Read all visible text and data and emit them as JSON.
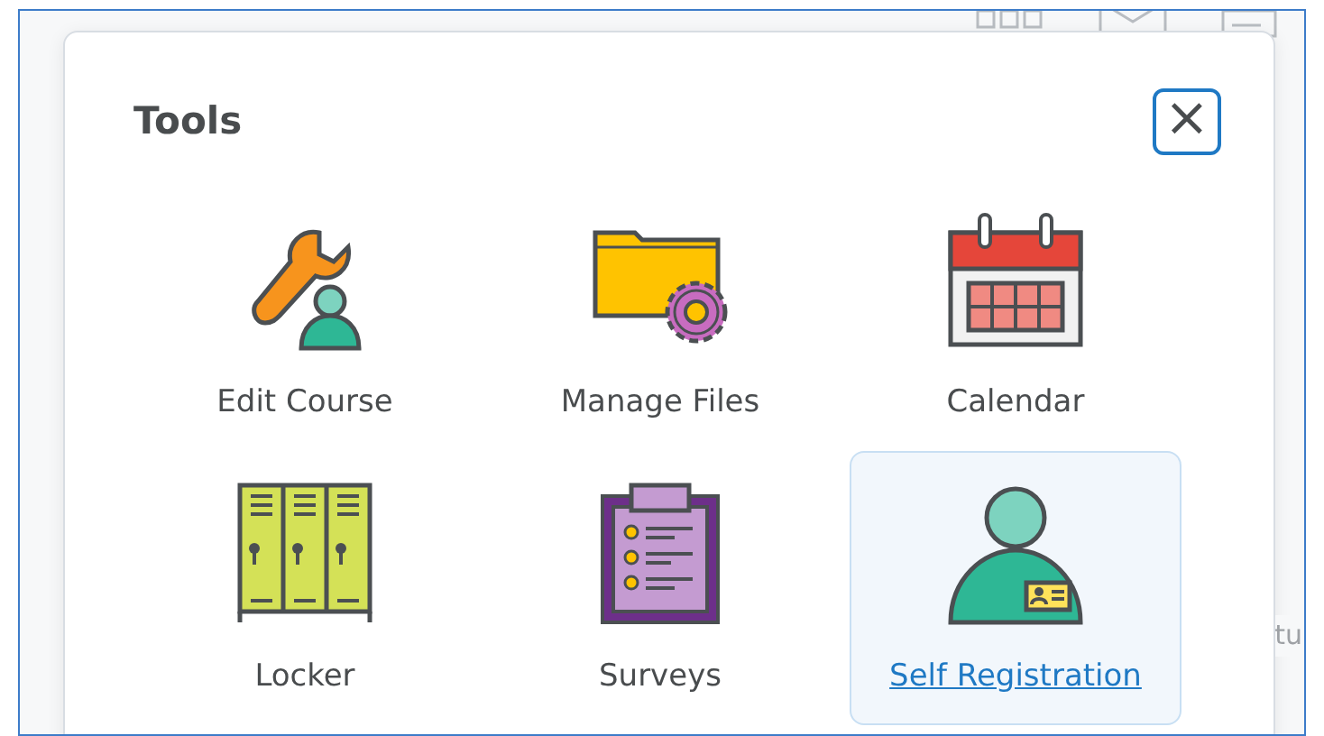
{
  "background": {
    "side_text": "tu"
  },
  "dialog": {
    "title": "Tools",
    "close_label": "×"
  },
  "tools": [
    {
      "label": "Edit Course",
      "kind": "wrench",
      "selected": false
    },
    {
      "label": "Manage Files",
      "kind": "folder",
      "selected": false
    },
    {
      "label": "Calendar",
      "kind": "calendar",
      "selected": false
    },
    {
      "label": "Locker",
      "kind": "locker",
      "selected": false
    },
    {
      "label": "Surveys",
      "kind": "clipboard",
      "selected": false
    },
    {
      "label": "Self Registration",
      "kind": "person",
      "selected": true
    }
  ]
}
